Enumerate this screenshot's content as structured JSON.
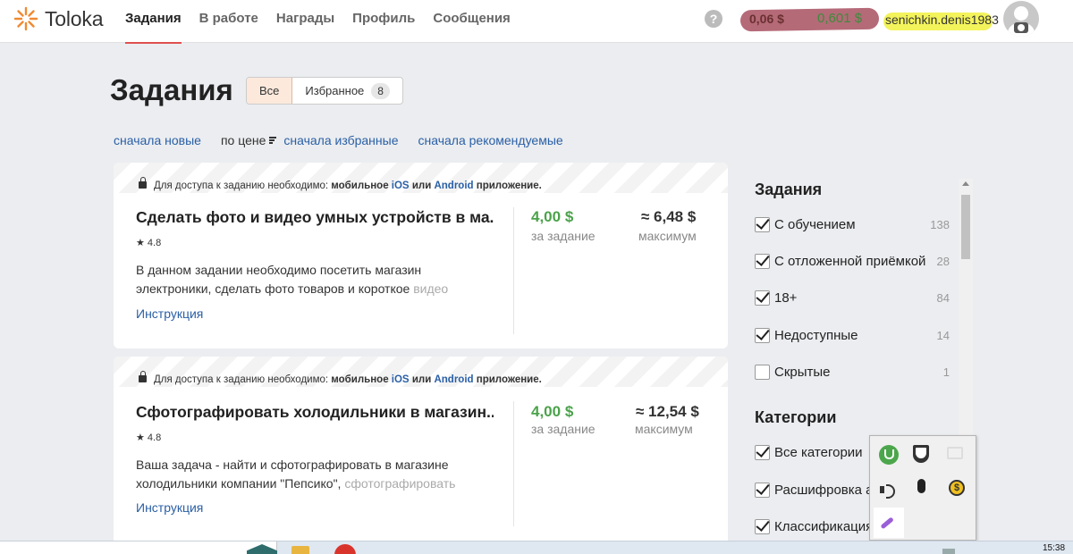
{
  "header": {
    "logo_text": "Toloka",
    "nav": [
      "Задания",
      "В работе",
      "Награды",
      "Профиль",
      "Сообщения"
    ],
    "help_label": "?",
    "balance_main": "0,06 $",
    "balance_second": "0,601 $",
    "username": "senichkin.denis1983"
  },
  "main": {
    "title": "Задания",
    "segments": {
      "all_label": "Все",
      "favorites_label": "Избранное",
      "favorites_count": "8"
    },
    "sorts": {
      "newest": "сначала новые",
      "by_price": "по цене",
      "favorites_first": "сначала избранные",
      "recommended_first": "сначала рекомендуемые"
    },
    "cards": [
      {
        "banner_prefix": "Для доступа к заданию необходимо:",
        "banner_bold": "мобильное",
        "banner_ios": "iOS",
        "banner_or": "или",
        "banner_android": "Android",
        "banner_suffix": "приложение.",
        "title": "Сделать фото и видео умных устройств в ма...",
        "rating": "★ 4.8",
        "desc_main": "В данном задании необходимо посетить магазин электроники, сделать фото товаров и короткое ",
        "desc_fade": "видео",
        "instruction": "Инструкция",
        "price": "4,00",
        "price_currency": "$",
        "price_label": "за задание",
        "max": "≈ 6,48",
        "max_currency": "$",
        "max_label": "максимум"
      },
      {
        "banner_prefix": "Для доступа к заданию необходимо:",
        "banner_bold": "мобильное",
        "banner_ios": "iOS",
        "banner_or": "или",
        "banner_android": "Android",
        "banner_suffix": "приложение.",
        "title": "Сфотографировать холодильники в магазин...",
        "rating": "★ 4.8",
        "desc_main": "Ваша задача - найти и сфотографировать в магазине холодильники компании \"Пепсико\", ",
        "desc_fade": "сфотографировать",
        "instruction": "Инструкция",
        "price": "4,00",
        "price_currency": "$",
        "price_label": "за задание",
        "max": "≈ 12,54",
        "max_currency": "$",
        "max_label": "максимум"
      }
    ]
  },
  "sidebar": {
    "tasks_title": "Задания",
    "task_filters": [
      {
        "label": "С обучением",
        "count": "138",
        "checked": true
      },
      {
        "label": "С отложенной приёмкой",
        "count": "28",
        "checked": true
      },
      {
        "label": "18+",
        "count": "84",
        "checked": true
      },
      {
        "label": "Недоступные",
        "count": "14",
        "checked": true
      },
      {
        "label": "Скрытые",
        "count": "1",
        "checked": false
      }
    ],
    "categories_title": "Категории",
    "category_filters": [
      {
        "label": "Все категории",
        "checked": true
      },
      {
        "label": "Расшифровка а",
        "checked": true
      },
      {
        "label": "Классификация",
        "checked": true
      }
    ]
  },
  "taskbar": {
    "clock": "15:38"
  },
  "colors": {
    "accent_red": "#e05050",
    "price_green": "#4aa24a",
    "link_blue": "#2a5fa5",
    "active_segment": "#fce9dc"
  }
}
